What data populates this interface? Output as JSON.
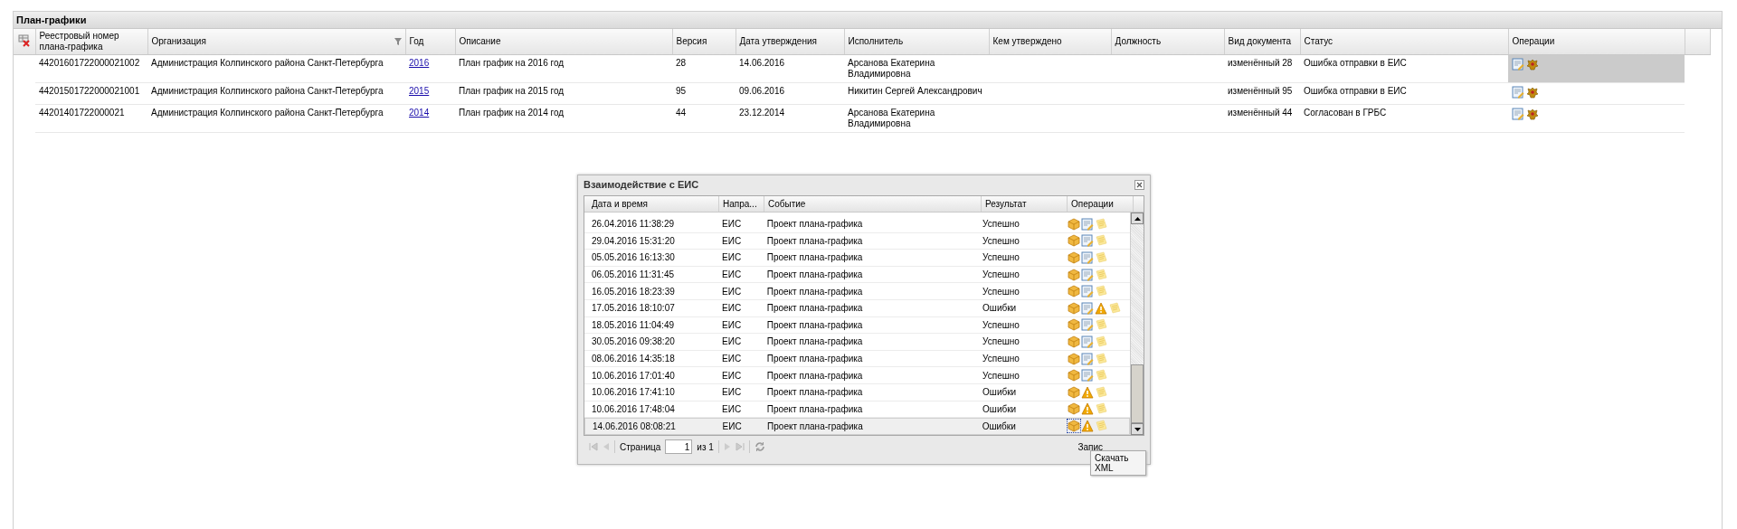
{
  "panel": {
    "title": "План-графики"
  },
  "table": {
    "columns": [
      "Реестровый номер плана-графика",
      "Организация",
      "Год",
      "Описание",
      "Версия",
      "Дата утверждения",
      "Исполнитель",
      "Кем утверждено",
      "Должность",
      "Вид документа",
      "Статус",
      "Операции"
    ],
    "rows": [
      {
        "reg_number": "44201601722000021002",
        "organization": "Администрация Колпинского района Санкт-Петербурга",
        "year": "2016",
        "description": "План график на 2016 год",
        "version": "28",
        "approved_date": "14.06.2016",
        "executor": "Арсанова Екатерина Владимировна",
        "doc_type": "изменённый 28",
        "status": "Ошибка отправки в ЕИС",
        "selected": true
      },
      {
        "reg_number": "44201501722000021001",
        "organization": "Администрация Колпинского района Санкт-Петербурга",
        "year": "2015",
        "description": "План график на 2015 год",
        "version": "95",
        "approved_date": "09.06.2016",
        "executor": "Никитин Сергей Александрович",
        "doc_type": "изменённый 95",
        "status": "Ошибка отправки в ЕИС",
        "selected": false
      },
      {
        "reg_number": "44201401722000021",
        "organization": "Администрация Колпинского района Санкт-Петербурга",
        "year": "2014",
        "description": "План график на 2014 год",
        "version": "44",
        "approved_date": "23.12.2014",
        "executor": "Арсанова Екатерина Владимировна",
        "doc_type": "изменённый 44",
        "status": "Согласован в ГРБС",
        "selected": false
      }
    ]
  },
  "dialog": {
    "title": "Взаимодействие с ЕИС",
    "columns": [
      "Дата и время",
      "Напра...",
      "Событие",
      "Результат",
      "Операции"
    ],
    "rows": [
      {
        "datetime": "26.04.2016 11:38:29",
        "direction": "ЕИС",
        "event": "Проект плана-графика",
        "result": "Успешно",
        "kind": "ok",
        "selected": false
      },
      {
        "datetime": "29.04.2016 15:31:20",
        "direction": "ЕИС",
        "event": "Проект плана-графика",
        "result": "Успешно",
        "kind": "ok",
        "selected": false
      },
      {
        "datetime": "05.05.2016 16:13:30",
        "direction": "ЕИС",
        "event": "Проект плана-графика",
        "result": "Успешно",
        "kind": "ok",
        "selected": false
      },
      {
        "datetime": "06.05.2016 11:31:45",
        "direction": "ЕИС",
        "event": "Проект плана-графика",
        "result": "Успешно",
        "kind": "ok",
        "selected": false
      },
      {
        "datetime": "16.05.2016 18:23:39",
        "direction": "ЕИС",
        "event": "Проект плана-графика",
        "result": "Успешно",
        "kind": "ok",
        "selected": false
      },
      {
        "datetime": "17.05.2016 18:10:07",
        "direction": "ЕИС",
        "event": "Проект плана-графика",
        "result": "Ошибки",
        "kind": "error_doc",
        "selected": false
      },
      {
        "datetime": "18.05.2016 11:04:49",
        "direction": "ЕИС",
        "event": "Проект плана-графика",
        "result": "Успешно",
        "kind": "ok",
        "selected": false
      },
      {
        "datetime": "30.05.2016 09:38:20",
        "direction": "ЕИС",
        "event": "Проект плана-графика",
        "result": "Успешно",
        "kind": "ok",
        "selected": false
      },
      {
        "datetime": "08.06.2016 14:35:18",
        "direction": "ЕИС",
        "event": "Проект плана-графика",
        "result": "Успешно",
        "kind": "ok",
        "selected": false
      },
      {
        "datetime": "10.06.2016 17:01:40",
        "direction": "ЕИС",
        "event": "Проект плана-графика",
        "result": "Успешно",
        "kind": "ok",
        "selected": false
      },
      {
        "datetime": "10.06.2016 17:41:10",
        "direction": "ЕИС",
        "event": "Проект плана-графика",
        "result": "Ошибки",
        "kind": "error",
        "selected": false
      },
      {
        "datetime": "10.06.2016 17:48:04",
        "direction": "ЕИС",
        "event": "Проект плана-графика",
        "result": "Ошибки",
        "kind": "error",
        "selected": false
      },
      {
        "datetime": "14.06.2016 08:08:21",
        "direction": "ЕИС",
        "event": "Проект плана-графика",
        "result": "Ошибки",
        "kind": "error",
        "selected": true
      }
    ],
    "pager": {
      "page_label": "Страница",
      "page": "1",
      "of_label": "из 1",
      "status": "Запис"
    },
    "tooltip": "Скачать XML"
  }
}
